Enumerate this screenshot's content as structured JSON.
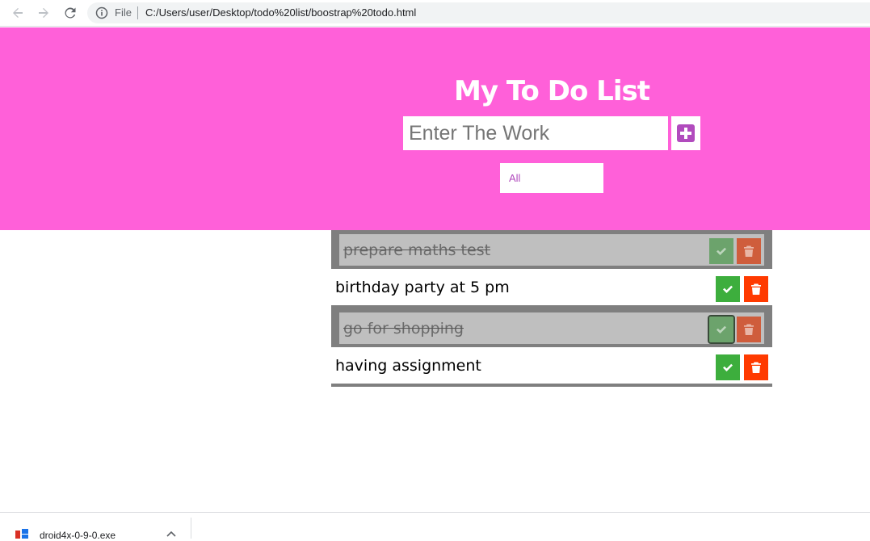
{
  "browser": {
    "scheme_label": "File",
    "url": "C:/Users/user/Desktop/todo%20list/boostrap%20todo.html"
  },
  "header": {
    "title": "My To Do List",
    "input_placeholder": "Enter The Work",
    "filter_value": "All",
    "background_color": "#ff60d9"
  },
  "todos": [
    {
      "text": "prepare maths test",
      "completed": true
    },
    {
      "text": "birthday party at 5 pm",
      "completed": false
    },
    {
      "text": "go for shopping",
      "completed": true
    },
    {
      "text": "having assignment",
      "completed": false
    }
  ],
  "colors": {
    "check_button": "#3dae3d",
    "trash_button": "#ff3a00",
    "accent_purple": "#b14bbd"
  },
  "download": {
    "file_name": "droid4x-0-9-0.exe"
  }
}
